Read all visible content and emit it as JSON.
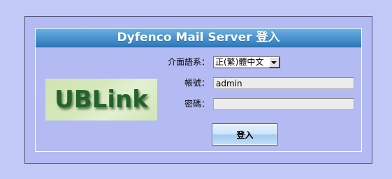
{
  "header": {
    "title": "Dyfenco Mail Server 登入"
  },
  "logo": {
    "text": "UBLink"
  },
  "form": {
    "language": {
      "label": "介面語系：",
      "selected": "正(繁)體中文"
    },
    "username": {
      "label": "帳號：",
      "value": "admin"
    },
    "password": {
      "label": "密碼：",
      "value": ""
    },
    "submit_label": "登入"
  },
  "icons": {
    "language_dropdown": "chevron-down-icon"
  },
  "colors": {
    "page_bg": "#c3c9f7",
    "box_bg": "#b4bbf3",
    "header_top": "#6cb1e3",
    "header_bottom": "#2c79ba",
    "header_text": "#ffffff",
    "logo_bg": "#d5e8bb",
    "logo_text": "#22632a",
    "input_bg": "#ececec",
    "button_top": "#e4f1fd",
    "button_bottom": "#a5caee"
  }
}
